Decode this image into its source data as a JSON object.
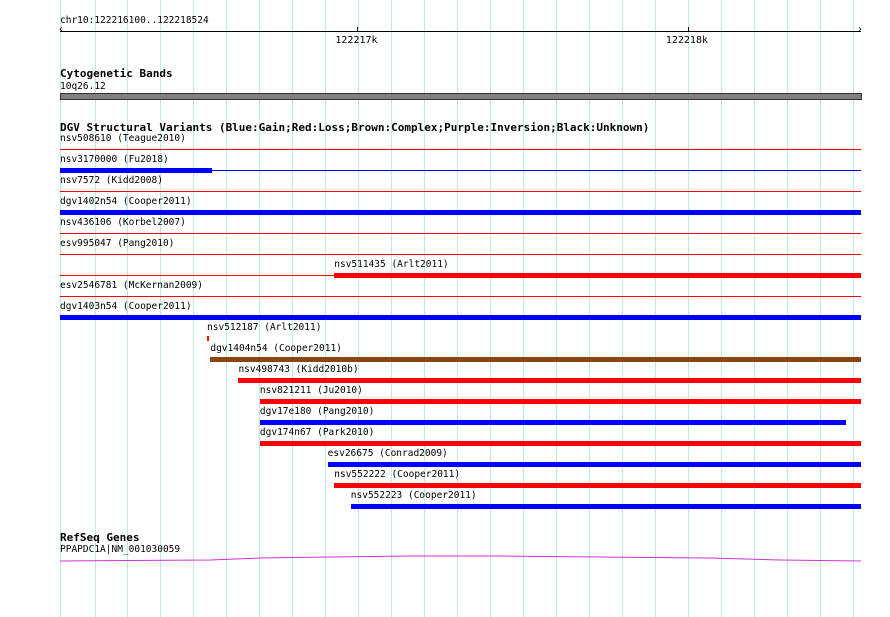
{
  "region": "chr10:122216100..122218524",
  "ticks": [
    {
      "label": "122217k",
      "pos": 122217000
    },
    {
      "label": "122218k",
      "pos": 122218000
    }
  ],
  "coord_range": [
    122216100,
    122218524
  ],
  "cytoband": {
    "title": "Cytogenetic Bands",
    "band": "10q26.12",
    "color": "#808080"
  },
  "dgv": {
    "title": "DGV Structural Variants (Blue:Gain;Red:Loss;Brown:Complex;Purple:Inversion;Black:Unknown)",
    "colors": {
      "gain": "#0000ff",
      "loss": "#ff0000",
      "complex": "#8b4513",
      "inversion": "#800080",
      "unknown": "#000000"
    },
    "variants": [
      {
        "label": "nsv508610 (Teague2010)",
        "type": "loss",
        "start": 122216100,
        "end": 122218524,
        "thin": true
      },
      {
        "label": "nsv3170000 (Fu2018)",
        "type": "gain",
        "start": 122216100,
        "end": 122216560,
        "thin_extends_to": 122218524
      },
      {
        "label": "nsv7572 (Kidd2008)",
        "type": "loss",
        "start": 122216100,
        "end": 122218524,
        "thin": true
      },
      {
        "label": "dgv1402n54 (Cooper2011)",
        "type": "gain",
        "start": 122216100,
        "end": 122218524
      },
      {
        "label": "nsv436106 (Korbel2007)",
        "type": "loss",
        "start": 122216100,
        "end": 122218524,
        "thin": true
      },
      {
        "label": "esv995047 (Pang2010)",
        "type": "loss",
        "start": 122216100,
        "end": 122218524,
        "thin": true
      },
      {
        "label": "nsv511435 (Arlt2011)",
        "type": "loss",
        "start": 122216930,
        "end": 122218524,
        "thin_from": 122216100
      },
      {
        "label": "esv2546781 (McKernan2009)",
        "type": "loss",
        "start": 122216100,
        "end": 122218524,
        "thin": true
      },
      {
        "label": "dgv1403n54 (Cooper2011)",
        "type": "gain",
        "start": 122216100,
        "end": 122218524
      },
      {
        "label": "nsv512187 (Arlt2011)",
        "type": "loss",
        "start": 122216545,
        "end": 122216550
      },
      {
        "label": "dgv1404n54 (Cooper2011)",
        "type": "complex",
        "start": 122216555,
        "end": 122218524
      },
      {
        "label": "nsv498743 (Kidd2010b)",
        "type": "loss",
        "start": 122216640,
        "end": 122218524
      },
      {
        "label": "nsv821211 (Ju2010)",
        "type": "loss",
        "start": 122216705,
        "end": 122218524
      },
      {
        "label": "dgv17e180 (Pang2010)",
        "type": "gain",
        "start": 122216705,
        "end": 122218480
      },
      {
        "label": "dgv174n67 (Park2010)",
        "type": "loss",
        "start": 122216705,
        "end": 122218524
      },
      {
        "label": "esv26675 (Conrad2009)",
        "type": "gain",
        "start": 122216910,
        "end": 122218524
      },
      {
        "label": "nsv552222 (Cooper2011)",
        "type": "loss",
        "start": 122216930,
        "end": 122218524
      },
      {
        "label": "nsv552223 (Cooper2011)",
        "type": "gain",
        "start": 122216980,
        "end": 122218524
      }
    ]
  },
  "refseq": {
    "title": "RefSeq Genes",
    "gene": "PPAPDC1A|NM_001030059",
    "color": "#cc33cc"
  }
}
